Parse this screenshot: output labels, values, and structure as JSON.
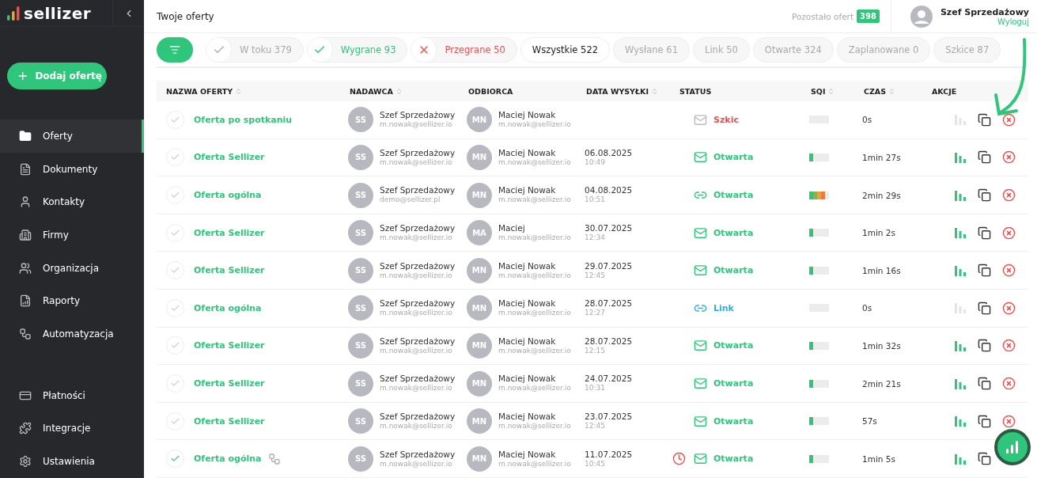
{
  "sidebar": {
    "logo": "sellizer",
    "add_button": "Dodaj ofertę",
    "items": [
      {
        "label": "Oferty",
        "selected": true
      },
      {
        "label": "Dokumenty",
        "selected": false
      },
      {
        "label": "Kontakty",
        "selected": false
      },
      {
        "label": "Firmy",
        "selected": false
      },
      {
        "label": "Organizacja",
        "selected": false
      },
      {
        "label": "Raporty",
        "selected": false
      },
      {
        "label": "Automatyzacja",
        "selected": false
      }
    ],
    "bottom_items": [
      {
        "label": "Płatności",
        "selected": false
      },
      {
        "label": "Integracje",
        "selected": false
      },
      {
        "label": "Ustawienia",
        "selected": false
      }
    ]
  },
  "header": {
    "title": "Twoje oferty",
    "remaining_label": "Pozostało ofert",
    "remaining_count": "398",
    "user_name": "Szef Sprzedażowy",
    "logout": "Wyloguj"
  },
  "filters": [
    {
      "label": "W toku 379",
      "kind": "pending",
      "selected": false
    },
    {
      "label": "Wygrane 93",
      "kind": "won",
      "selected": false
    },
    {
      "label": "Przegrane 50",
      "kind": "lost",
      "selected": false
    },
    {
      "label": "Wszystkie 522",
      "kind": "plain",
      "selected": true
    },
    {
      "label": "Wysłane 61",
      "kind": "plain",
      "selected": false
    },
    {
      "label": "Link 50",
      "kind": "plain",
      "selected": false
    },
    {
      "label": "Otwarte 324",
      "kind": "plain",
      "selected": false
    },
    {
      "label": "Zaplanowane 0",
      "kind": "plain",
      "selected": false
    },
    {
      "label": "Szkice 87",
      "kind": "plain",
      "selected": false
    }
  ],
  "table": {
    "columns": [
      {
        "label": "NAZWA OFERTY",
        "sortable": true
      },
      {
        "label": "NADAWCA",
        "sortable": true
      },
      {
        "label": "ODBIORCA",
        "sortable": false
      },
      {
        "label": "DATA WYSYŁKI",
        "sortable": true
      },
      {
        "label": "STATUS",
        "sortable": false
      },
      {
        "label": "SQI",
        "sortable": true
      },
      {
        "label": "CZAS",
        "sortable": true
      },
      {
        "label": "AKCJE",
        "sortable": false
      }
    ],
    "rows": [
      {
        "checked": false,
        "name": "Oferta po spotkaniu",
        "automation": false,
        "sender_initials": "SS",
        "sender": "Szef Sprzedażowy",
        "sender_email": "m.nowak@sellizer.io",
        "recipient_initials": "MN",
        "recipient": "Maciej Nowak",
        "recipient_email": "m.nowak@sellizer.io",
        "scheduled": false,
        "kind": "draft",
        "color": "#f04d4d",
        "status": "Szkic",
        "level": 0,
        "time": "0s",
        "stats_active": false
      },
      {
        "checked": false,
        "name": "Oferta Sellizer",
        "automation": false,
        "sender_initials": "SS",
        "sender": "Szef Sprzedażowy",
        "sender_email": "m.nowak@sellizer.io",
        "recipient_initials": "MN",
        "recipient": "Maciej Nowak",
        "recipient_email": "m.nowak@sellizer.io",
        "date": "06.08.2025",
        "hour": "10:49",
        "scheduled": false,
        "kind": "mail",
        "color": "#2fc57a",
        "status": "Otwarta",
        "level": 0.2,
        "time": "1min 27s",
        "stats_active": true
      },
      {
        "checked": false,
        "name": "Oferta ogólna",
        "automation": false,
        "sender_initials": "SS",
        "sender": "Szef Sprzedażowy",
        "sender_email": "demo@sellizer.pl",
        "recipient_initials": "MN",
        "recipient": "Maciej Nowak",
        "recipient_email": "m.nowak@sellizer.io",
        "date": "04.08.2025",
        "hour": "10:51",
        "scheduled": false,
        "kind": "link",
        "color": "#2fc57a",
        "status": "Otwarta",
        "level": 0.8,
        "time": "2min 29s",
        "stats_active": true
      },
      {
        "checked": false,
        "name": "Oferta Sellizer",
        "automation": false,
        "sender_initials": "SS",
        "sender": "Szef Sprzedażowy",
        "sender_email": "m.nowak@sellizer.io",
        "recipient_initials": "MA",
        "recipient": "Maciej",
        "recipient_email": "m.nowak@sellizer.io",
        "date": "30.07.2025",
        "hour": "12:34",
        "scheduled": false,
        "kind": "mail",
        "color": "#2fc57a",
        "status": "Otwarta",
        "level": 0.2,
        "time": "1min 2s",
        "stats_active": true
      },
      {
        "checked": false,
        "name": "Oferta Sellizer",
        "automation": false,
        "sender_initials": "SS",
        "sender": "Szef Sprzedażowy",
        "sender_email": "m.nowak@sellizer.io",
        "recipient_initials": "MN",
        "recipient": "Maciej Nowak",
        "recipient_email": "m.nowak@sellizer.io",
        "date": "29.07.2025",
        "hour": "12:45",
        "scheduled": false,
        "kind": "mail",
        "color": "#2fc57a",
        "status": "Otwarta",
        "level": 0.2,
        "time": "1min 16s",
        "stats_active": true
      },
      {
        "checked": false,
        "name": "Oferta ogólna",
        "automation": false,
        "sender_initials": "SS",
        "sender": "Szef Sprzedażowy",
        "sender_email": "m.nowak@sellizer.io",
        "recipient_initials": "MN",
        "recipient": "Maciej Nowak",
        "recipient_email": "m.nowak@sellizer.io",
        "date": "28.07.2025",
        "hour": "12:27",
        "scheduled": false,
        "kind": "link",
        "color": "#2ab0e0",
        "status": "Link",
        "level": 0,
        "time": "0s",
        "stats_active": false
      },
      {
        "checked": false,
        "name": "Oferta Sellizer",
        "automation": false,
        "sender_initials": "SS",
        "sender": "Szef Sprzedażowy",
        "sender_email": "m.nowak@sellizer.io",
        "recipient_initials": "MN",
        "recipient": "Maciej Nowak",
        "recipient_email": "m.nowak@sellizer.io",
        "date": "28.07.2025",
        "hour": "12:15",
        "scheduled": false,
        "kind": "mail",
        "color": "#2fc57a",
        "status": "Otwarta",
        "level": 0.2,
        "time": "1min 32s",
        "stats_active": true
      },
      {
        "checked": false,
        "name": "Oferta Sellizer",
        "automation": false,
        "sender_initials": "SS",
        "sender": "Szef Sprzedażowy",
        "sender_email": "m.nowak@sellizer.io",
        "recipient_initials": "MN",
        "recipient": "Maciej Nowak",
        "recipient_email": "m.nowak@sellizer.io",
        "date": "24.07.2025",
        "hour": "10:31",
        "scheduled": false,
        "kind": "mail",
        "color": "#2fc57a",
        "status": "Otwarta",
        "level": 0.2,
        "time": "2min 21s",
        "stats_active": true
      },
      {
        "checked": false,
        "name": "Oferta Sellizer",
        "automation": false,
        "sender_initials": "SS",
        "sender": "Szef Sprzedażowy",
        "sender_email": "m.nowak@sellizer.io",
        "recipient_initials": "MN",
        "recipient": "Maciej Nowak",
        "recipient_email": "m.nowak@sellizer.io",
        "date": "23.07.2025",
        "hour": "12:45",
        "scheduled": false,
        "kind": "mail",
        "color": "#2fc57a",
        "status": "Otwarta",
        "level": 0.2,
        "time": "57s",
        "stats_active": true
      },
      {
        "checked": true,
        "name": "Oferta ogólna",
        "automation": true,
        "sender_initials": "SS",
        "sender": "Szef Sprzedażowy",
        "sender_email": "m.nowak@sellizer.io",
        "recipient_initials": "MN",
        "recipient": "Maciej Nowak",
        "recipient_email": "m.nowak@sellizer.io",
        "date": "11.07.2025",
        "hour": "10:45",
        "scheduled": true,
        "kind": "mail",
        "color": "#2fc57a",
        "status": "Otwarta",
        "level": 0.2,
        "time": "1min 5s",
        "stats_active": true
      }
    ]
  }
}
